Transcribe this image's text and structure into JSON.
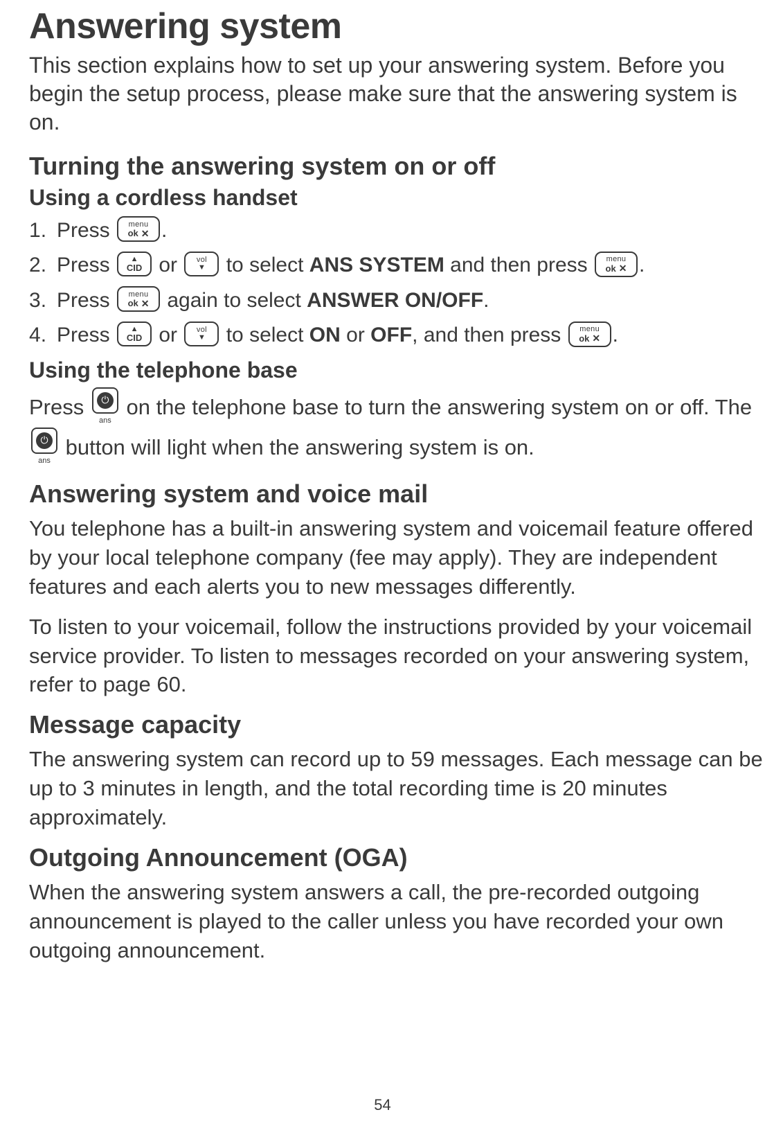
{
  "page_number": "54",
  "title": "Answering system",
  "intro": "This section explains how to set up your answering system. Before you begin the setup process, please make sure that the answering system is on.",
  "sect1": {
    "heading": "Turning the answering system on or off",
    "sub_a": "Using a cordless handset",
    "steps": {
      "s1_a": "Press ",
      "s1_b": ".",
      "s2_a": "Press ",
      "s2_b": " or ",
      "s2_c": " to select ",
      "s2_bold": "ANS SYSTEM",
      "s2_d": " and then press ",
      "s2_e": ".",
      "s3_a": "Press ",
      "s3_b": " again to select ",
      "s3_bold": "ANSWER ON/OFF",
      "s3_c": ".",
      "s4_a": "Press ",
      "s4_b": " or ",
      "s4_c": " to select ",
      "s4_bold1": "ON",
      "s4_mid": " or ",
      "s4_bold2": "OFF",
      "s4_d": ", and then press ",
      "s4_e": "."
    },
    "sub_b": "Using the telephone base",
    "base_a": "Press ",
    "base_b": " on the telephone base to turn the answering system on or off. The ",
    "base_c": " button will light when the answering system is on."
  },
  "sect2": {
    "heading": "Answering system and voice mail",
    "p1": "You telephone has a built-in answering system and voicemail feature offered by your local telephone company (fee may apply). They are independent features and each alerts you to new messages differently.",
    "p2": "To listen to your voicemail, follow the instructions provided by your voicemail service provider. To listen to messages recorded on your answering system, refer to page 60."
  },
  "sect3": {
    "heading": "Message capacity",
    "p1": "The answering system can record up to 59 messages. Each message can be up to 3 minutes in length, and the total recording time is 20 minutes approximately."
  },
  "sect4": {
    "heading": "Outgoing Announcement (OGA)",
    "p1": "When the answering system answers a call, the pre-recorded outgoing announcement is played to the caller unless you have recorded your own outgoing announcement."
  },
  "keys": {
    "menuok_top": "menu",
    "menuok_bot": "ok",
    "cid_top": "▲",
    "cid_bot": "CID",
    "vol_top": "vol",
    "vol_bot": "▼",
    "ans_label": "ans",
    "mute_glyph": "✕"
  }
}
